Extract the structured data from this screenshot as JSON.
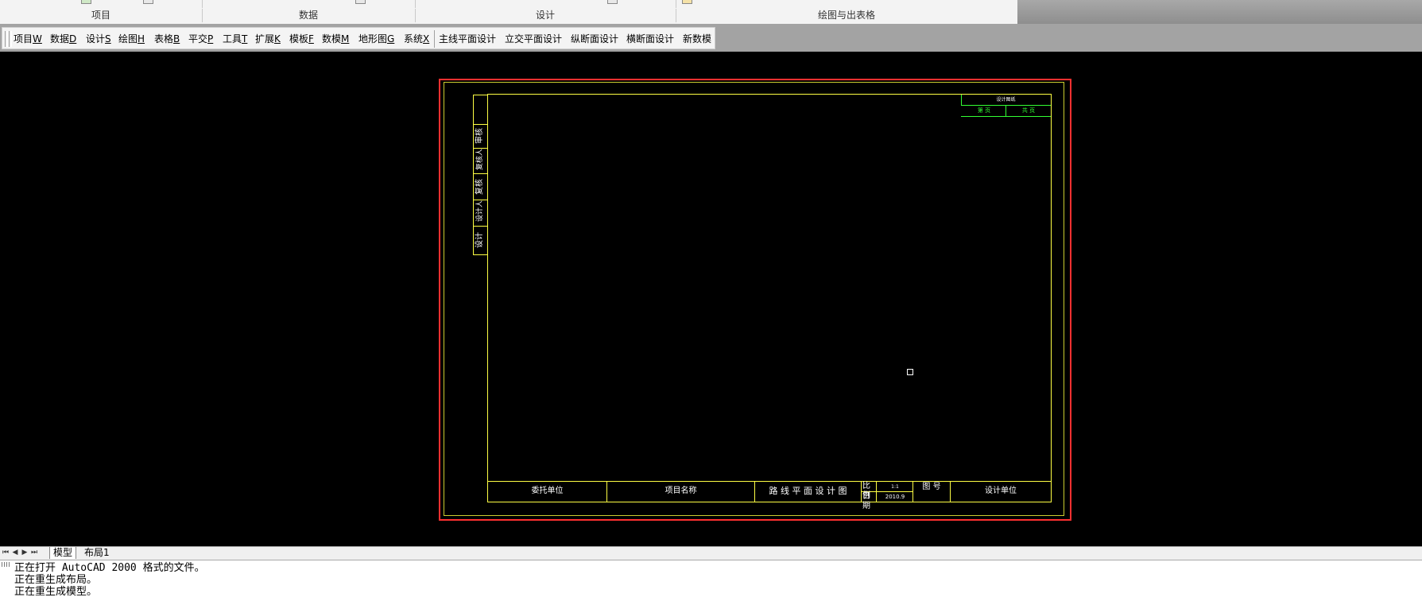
{
  "ribbon": {
    "panels": [
      "项目",
      "数据",
      "设计",
      "绘图与出表格"
    ]
  },
  "toolbar": {
    "menu_items": [
      {
        "text": "项目",
        "key": "W"
      },
      {
        "text": "数据",
        "key": "D"
      },
      {
        "text": "设计",
        "key": "S"
      },
      {
        "text": "绘图",
        "key": "H"
      },
      {
        "text": "表格",
        "key": "B"
      },
      {
        "text": "平交",
        "key": "P"
      },
      {
        "text": "工具",
        "key": "T"
      },
      {
        "text": "扩展",
        "key": "K"
      },
      {
        "text": "模板",
        "key": "F"
      },
      {
        "text": "数模",
        "key": "M"
      },
      {
        "text": "地形图",
        "key": "G"
      },
      {
        "text": "系统",
        "key": "X"
      }
    ],
    "design_buttons": [
      "主线平面设计",
      "立交平面设计",
      "纵断面设计",
      "横断面设计",
      "新数模"
    ]
  },
  "drawing": {
    "side_labels": [
      "审核",
      "复核人",
      "复核",
      "设计人",
      "设计"
    ],
    "title_block": {
      "client_unit": "委托单位",
      "project_name": "项目名称",
      "drawing_title": "路 线 平 面 设 计 图",
      "scale_label": "比例",
      "scale_value": "1:1",
      "date_label": "日期",
      "date_value": "2010.9",
      "drawing_no_label": "图 号",
      "design_unit": "设计单位"
    },
    "corner_block": {
      "title": "设计图纸",
      "left_text": "第 页",
      "right_text": "共 页"
    },
    "colors": {
      "outer_frame": "#ff3030",
      "inner_frame": "#ffff44",
      "corner_block": "#33ff33"
    }
  },
  "tabs": {
    "model": "模型",
    "layout1": "布局1"
  },
  "command_lines": [
    "正在打开 AutoCAD 2000 格式的文件。",
    "正在重生成布局。",
    "正在重生成模型。"
  ]
}
